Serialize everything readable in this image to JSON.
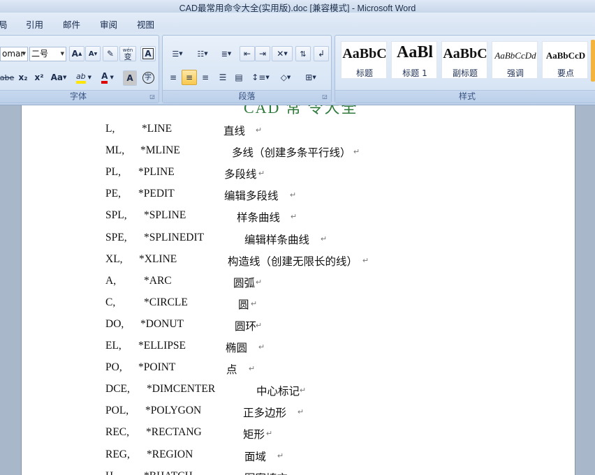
{
  "window": {
    "title": "CAD最常用命令大全(实用版).doc [兼容模式] - Microsoft Word"
  },
  "tabs": [
    "局",
    "引用",
    "邮件",
    "审阅",
    "视图"
  ],
  "ribbon": {
    "font_group": {
      "label": "字体",
      "font_name": "omar",
      "font_size": "二号",
      "grow_font": "A",
      "shrink_font": "A",
      "phonetic": "wén",
      "strikethrough": "abe",
      "subscript": "x₂",
      "superscript": "x²",
      "change_case": "Aa",
      "highlight": "ab",
      "font_color": "A",
      "char_shading": "A",
      "enclose": "字"
    },
    "paragraph_group": {
      "label": "段落"
    },
    "styles_group": {
      "label": "样式",
      "items": [
        {
          "sample": "AaBbC",
          "name": "标题"
        },
        {
          "sample": "AaBl",
          "name": "标题 1"
        },
        {
          "sample": "AaBbC",
          "name": "副标题"
        },
        {
          "sample": "AaBbCcDd",
          "name": "强调"
        },
        {
          "sample": "AaBbCcD",
          "name": "要点"
        }
      ]
    }
  },
  "document": {
    "heading_partial": "CAD 常 令大全",
    "paragraph_mark": "↵",
    "commands": [
      {
        "alias": "L,",
        "command": "*LINE",
        "desc": "直线"
      },
      {
        "alias": "ML,",
        "command": "*MLINE",
        "desc": "多线（创建多条平行线）"
      },
      {
        "alias": "PL,",
        "command": "*PLINE",
        "desc": "多段线"
      },
      {
        "alias": "PE,",
        "command": "*PEDIT",
        "desc": "编辑多段线"
      },
      {
        "alias": "SPL,",
        "command": "*SPLINE",
        "desc": "样条曲线"
      },
      {
        "alias": "SPE,",
        "command": "*SPLINEDIT",
        "desc": "编辑样条曲线"
      },
      {
        "alias": "XL,",
        "command": "*XLINE",
        "desc": "构造线（创建无限长的线）"
      },
      {
        "alias": "A,",
        "command": "*ARC",
        "desc": "圆弧"
      },
      {
        "alias": "C,",
        "command": "*CIRCLE",
        "desc": "圆"
      },
      {
        "alias": "DO,",
        "command": "*DONUT",
        "desc": "圆环"
      },
      {
        "alias": "EL,",
        "command": "*ELLIPSE",
        "desc": "椭圆"
      },
      {
        "alias": "PO,",
        "command": "*POINT",
        "desc": "点"
      },
      {
        "alias": "DCE,",
        "command": "*DIMCENTER",
        "desc": "中心标记"
      },
      {
        "alias": "POL,",
        "command": "*POLYGON",
        "desc": "正多边形"
      },
      {
        "alias": "REC,",
        "command": "*RECTANG",
        "desc": "矩形"
      },
      {
        "alias": "REG,",
        "command": "*REGION",
        "desc": "面域"
      },
      {
        "alias": "H,",
        "command": "*BHATCH",
        "desc": "图案填充"
      }
    ]
  }
}
